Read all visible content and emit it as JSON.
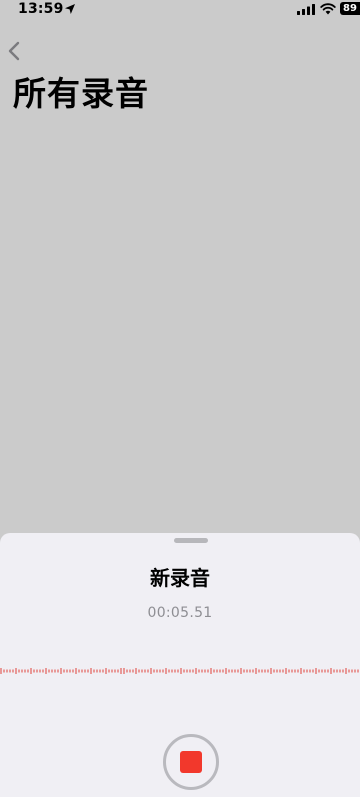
{
  "status_bar": {
    "time": "13:59",
    "battery": "89",
    "icons": [
      "location-arrow-icon",
      "cellular-signal-icon",
      "wifi-icon",
      "battery-icon"
    ]
  },
  "header": {
    "back_icon": "chevron-left-icon",
    "title": "所有录音"
  },
  "recording_sheet": {
    "title": "新录音",
    "duration": "00:05.51",
    "waveform_color": "#e0413a",
    "stop_button_icon": "stop-icon",
    "stop_color": "#f2382c"
  },
  "colors": {
    "dimmed_background": "#cbcbcb",
    "sheet_background": "#f0eff4",
    "secondary_text": "#8e8e93"
  }
}
